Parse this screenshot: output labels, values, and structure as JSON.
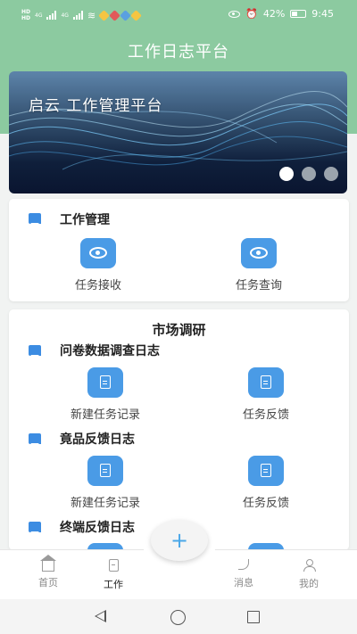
{
  "status_bar": {
    "left": {
      "hd_labels": [
        "HD",
        "HD"
      ],
      "network_labels": [
        "4G",
        "4G"
      ]
    },
    "battery_percent": "42%",
    "battery_level": 0.42,
    "time": "9:45"
  },
  "header": {
    "title": "工作日志平台"
  },
  "banner": {
    "text": "启云 工作管理平台",
    "page_count": 3,
    "active_index": 0
  },
  "work_management": {
    "title": "工作管理",
    "tiles": [
      {
        "label": "任务接收",
        "icon": "eye-icon"
      },
      {
        "label": "任务查询",
        "icon": "eye-icon"
      }
    ]
  },
  "market_research": {
    "title": "市场调研",
    "sections": [
      {
        "title": "问卷数据调查日志",
        "tiles": [
          {
            "label": "新建任务记录",
            "icon": "document-icon"
          },
          {
            "label": "任务反馈",
            "icon": "document-icon"
          }
        ]
      },
      {
        "title": "竟品反馈日志",
        "tiles": [
          {
            "label": "新建任务记录",
            "icon": "document-icon"
          },
          {
            "label": "任务反馈",
            "icon": "document-icon"
          }
        ]
      },
      {
        "title": "终端反馈日志",
        "tiles": []
      }
    ]
  },
  "bottom_nav": {
    "items": [
      {
        "label": "首页",
        "icon": "home-icon",
        "active": false
      },
      {
        "label": "工作",
        "icon": "work-icon",
        "active": true
      },
      {
        "label": "消息",
        "icon": "phone-icon",
        "active": false
      },
      {
        "label": "我的",
        "icon": "user-icon",
        "active": false
      }
    ],
    "fab_symbol": "+"
  },
  "colors": {
    "header_green": "#8ccaa0",
    "accent_blue": "#4a9be6",
    "fab_plus": "#4aa7e8"
  }
}
